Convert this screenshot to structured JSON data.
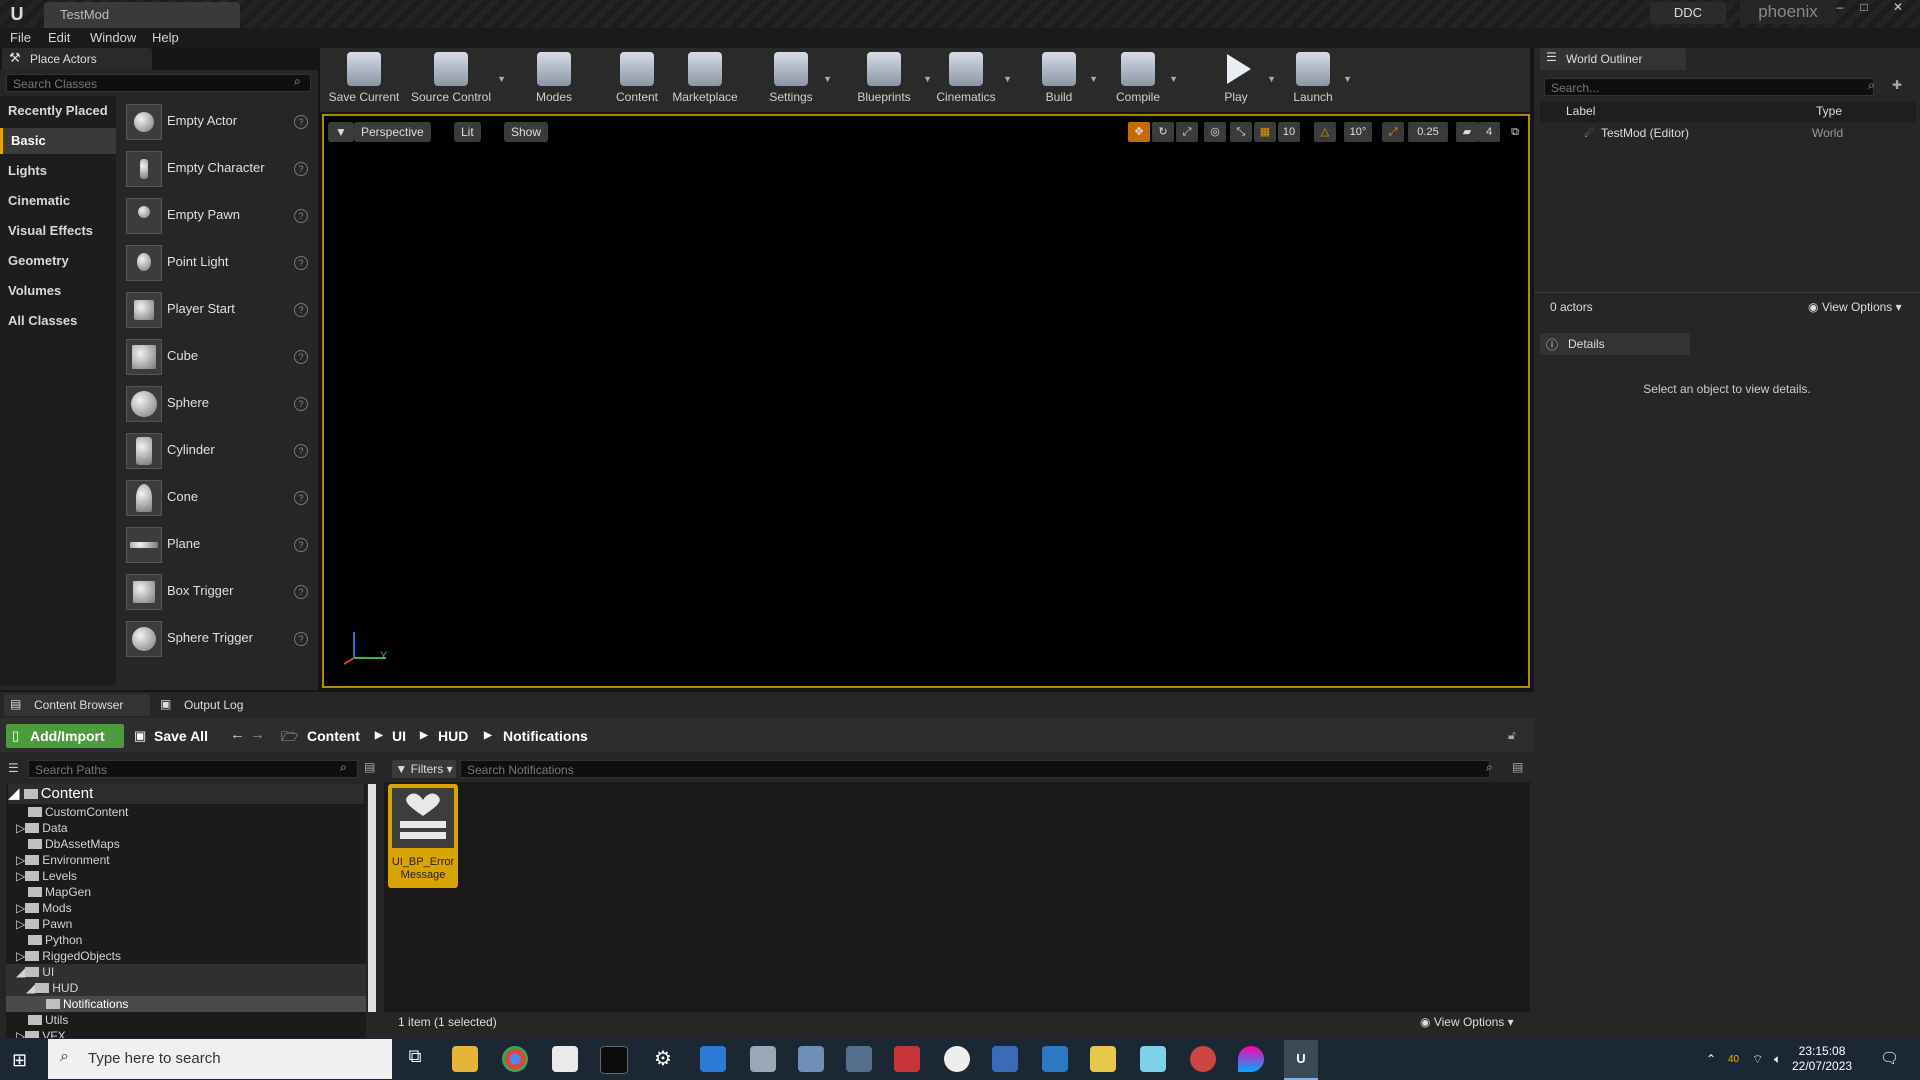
{
  "window": {
    "tab_title": "TestMod",
    "ddc_label": "DDC",
    "project_name": "phoenix"
  },
  "menu": [
    "File",
    "Edit",
    "Window",
    "Help"
  ],
  "place_actors": {
    "tab_label": "Place Actors",
    "search_placeholder": "Search Classes",
    "categories": [
      "Recently Placed",
      "Basic",
      "Lights",
      "Cinematic",
      "Visual Effects",
      "Geometry",
      "Volumes",
      "All Classes"
    ],
    "active_category": "Basic",
    "actors": [
      "Empty Actor",
      "Empty Character",
      "Empty Pawn",
      "Point Light",
      "Player Start",
      "Cube",
      "Sphere",
      "Cylinder",
      "Cone",
      "Plane",
      "Box Trigger",
      "Sphere Trigger"
    ]
  },
  "toolbar": {
    "buttons": [
      "Save Current",
      "Source Control",
      "Modes",
      "Content",
      "Marketplace",
      "Settings",
      "Blueprints",
      "Cinematics",
      "Build",
      "Compile",
      "Play",
      "Launch"
    ]
  },
  "viewport": {
    "perspective_label": "Perspective",
    "lit_label": "Lit",
    "show_label": "Show",
    "grid_size": "10",
    "rotation_snap": "10°",
    "scale_snap": "0.25",
    "camera_speed": "4",
    "axis_y": "Y"
  },
  "world_outliner": {
    "tab_label": "World Outliner",
    "search_placeholder": "Search...",
    "col_label": "Label",
    "col_type": "Type",
    "row_label": "TestMod (Editor)",
    "row_type": "World",
    "actor_count": "0 actors",
    "view_options": "View Options"
  },
  "details": {
    "tab_label": "Details",
    "empty_message": "Select an object to view details."
  },
  "content_browser": {
    "tab_label": "Content Browser",
    "output_tab_label": "Output Log",
    "add_import": "Add/Import",
    "save_all": "Save All",
    "breadcrumb": [
      "Content",
      "UI",
      "HUD",
      "Notifications"
    ],
    "search_paths_placeholder": "Search Paths",
    "filters": "Filters",
    "search_placeholder": "Search Notifications",
    "tree_root": "Content",
    "tree": [
      "CustomContent",
      "Data",
      "DbAssetMaps",
      "Environment",
      "Levels",
      "MapGen",
      "Mods",
      "Pawn",
      "Python",
      "RiggedObjects",
      "UI",
      "HUD",
      "Notifications",
      "Utils",
      "VFX"
    ],
    "asset_name": "UI_BP_Error Message",
    "item_count": "1 item (1 selected)",
    "view_options": "View Options"
  },
  "taskbar": {
    "search_placeholder": "Type here to search",
    "time": "23:15:08",
    "date": "22/07/2023",
    "temp": "40"
  }
}
